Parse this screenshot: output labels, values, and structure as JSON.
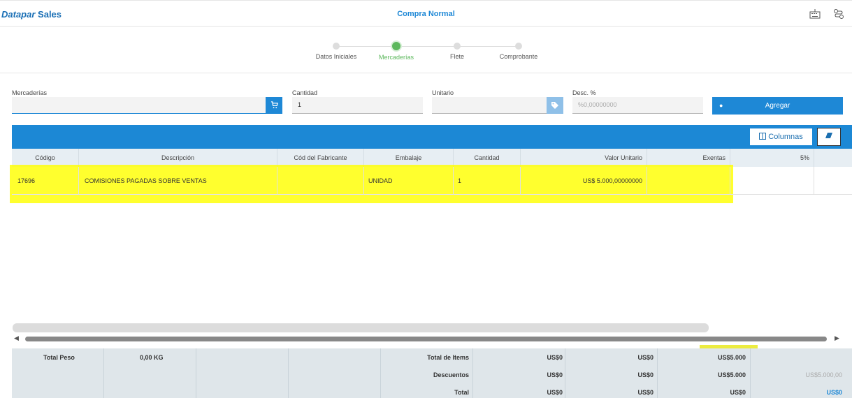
{
  "app": {
    "brand_part1": "Datapar",
    "brand_part2": "Sales",
    "title": "Compra Normal"
  },
  "header_icons": [
    "keyboard-icon",
    "route-icon"
  ],
  "stepper": {
    "steps": [
      "Datos Iniciales",
      "Mercaderías",
      "Flete",
      "Comprobante"
    ],
    "active_index": 1
  },
  "form": {
    "mercaderias_label": "Mercaderías",
    "mercaderias_value": "",
    "cantidad_label": "Cantidad",
    "cantidad_value": "1",
    "unitario_label": "Unitario",
    "unitario_value": "",
    "desc_label": "Desc. %",
    "desc_placeholder": "%0,00000000",
    "agregar_label": "Agregar"
  },
  "toolbar": {
    "columnas_label": "Columnas"
  },
  "table": {
    "headers": [
      "Código",
      "Descripción",
      "Cód del Fabricante",
      "Embalaje",
      "Cantidad",
      "Valor Unitario",
      "Exentas",
      "5%"
    ],
    "rows": [
      {
        "codigo": "17696",
        "descripcion": "COMISIONES PAGADAS SOBRE VENTAS",
        "cod_fabricante": "",
        "embalaje": "UNIDAD",
        "cantidad": "1",
        "valor_unitario": "US$ 5.000,00000000",
        "exentas": "",
        "cinco": ""
      }
    ]
  },
  "totals": {
    "total_peso_label": "Total Peso",
    "total_peso_value": "0,00 KG",
    "rows": [
      {
        "label": "Total de Items",
        "v1": "US$0",
        "v2": "US$0",
        "v3": "US$5.000",
        "v4": ""
      },
      {
        "label": "Descuentos",
        "v1": "US$0",
        "v2": "US$0",
        "v3": "US$5.000",
        "v4": "US$5.000,00"
      },
      {
        "label": "Total",
        "v1": "US$0",
        "v2": "US$0",
        "v3": "US$0",
        "v4": "US$0"
      }
    ]
  },
  "colors": {
    "accent": "#1e88d6",
    "active_step": "#5cb85c",
    "highlight": "#ffff00"
  }
}
